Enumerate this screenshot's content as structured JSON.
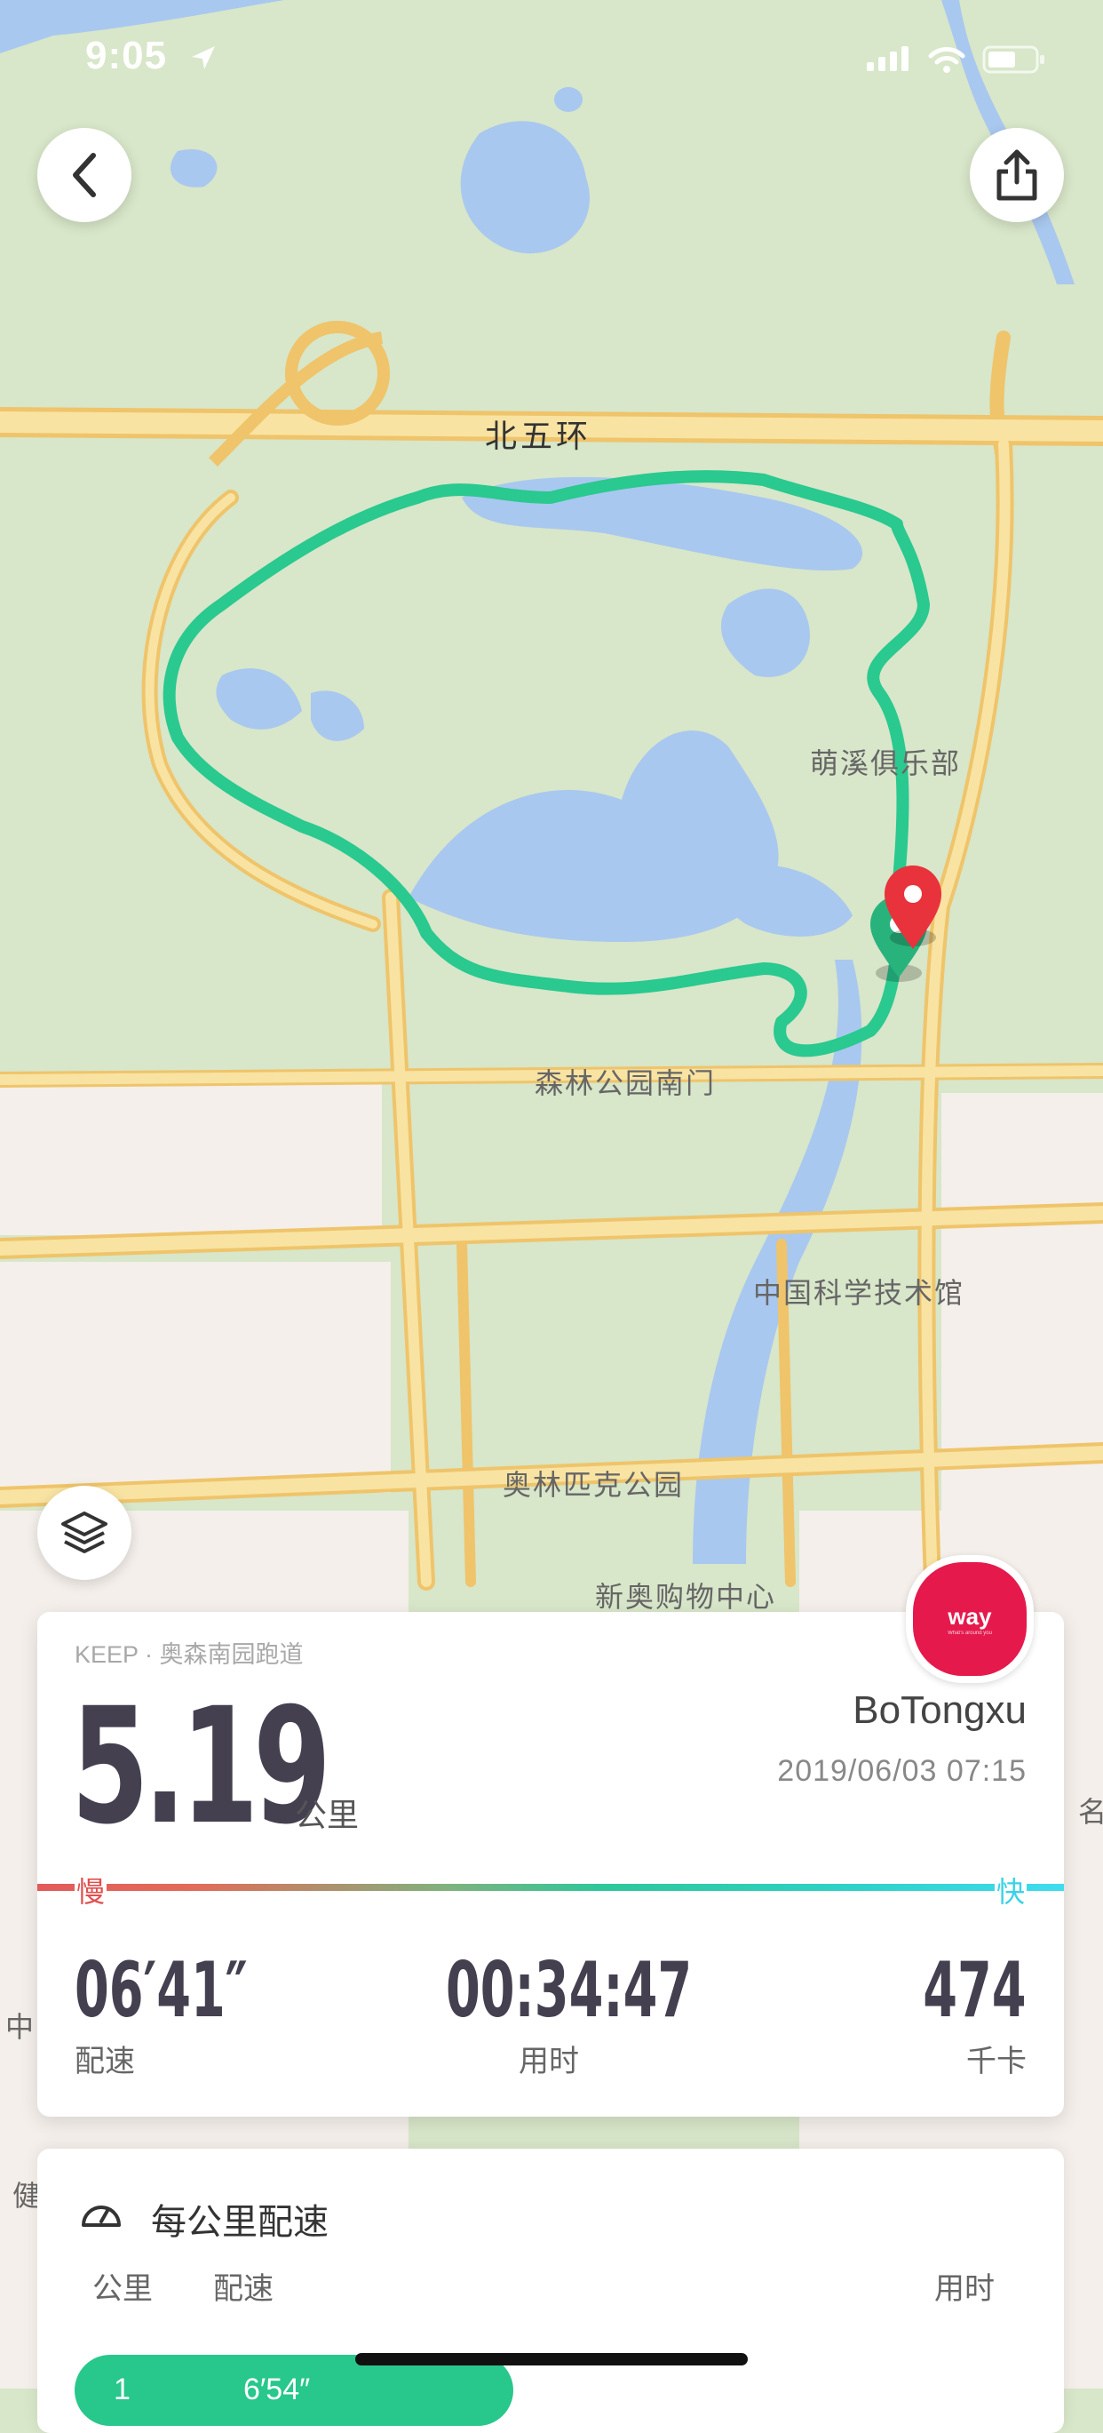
{
  "status_bar": {
    "time": "9:05"
  },
  "map": {
    "labels": {
      "north_fifth_ring": "北五环",
      "mengxi_club": "萌溪俱乐部",
      "forest_park_south_gate": "森林公园南门",
      "china_science_museum": "中国科学技术馆",
      "olympic_park": "奥林匹克公园",
      "xinao_mall": "新奥购物中心"
    },
    "edge_labels": {
      "right": "名",
      "left_mid": "中",
      "left_low": "健"
    },
    "colors": {
      "land": "#d8e6c9",
      "water": "#a9c8ef",
      "road": "#f7dc8e",
      "road_edge": "#efc46a",
      "route": "#29c98f",
      "urban": "#f3eee9"
    }
  },
  "card": {
    "source": "KEEP · 奥森南园跑道",
    "distance": "5.19",
    "distance_unit": "公里",
    "user": "BoTongxu",
    "date": "2019/06/03 07:15",
    "badge_text": "way",
    "badge_sub": "What's around you",
    "pace_slow": "慢",
    "pace_fast": "快",
    "stats": [
      {
        "value": "06′41″",
        "label": "配速"
      },
      {
        "value": "00:34:47",
        "label": "用时"
      },
      {
        "value": "474",
        "label": "千卡"
      }
    ]
  },
  "splits": {
    "title": "每公里配速",
    "col_km": "公里",
    "col_pace": "配速",
    "col_time": "用时",
    "rows": [
      {
        "km": "1",
        "pace": "6′54″"
      }
    ]
  }
}
